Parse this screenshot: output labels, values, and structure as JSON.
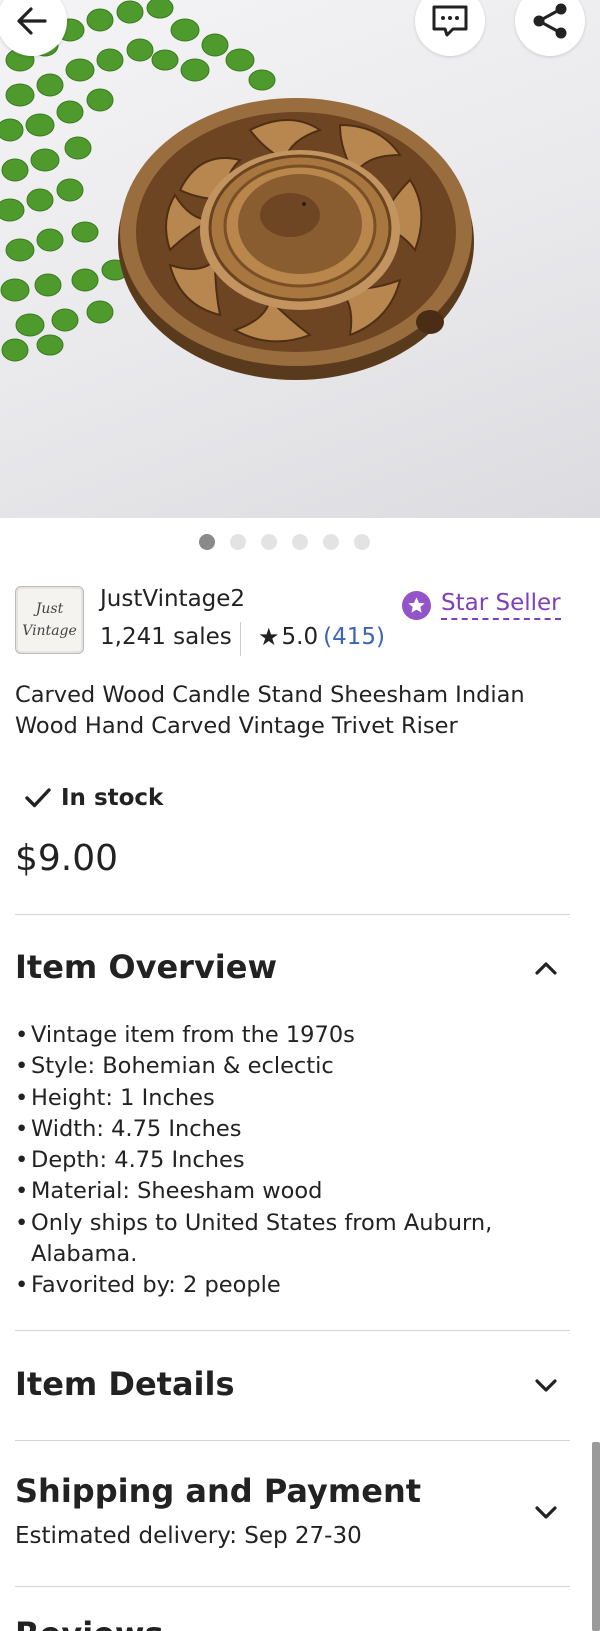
{
  "header": {
    "back_icon": "arrow-left-icon",
    "message_icon": "message-icon",
    "share_icon": "share-icon"
  },
  "carousel": {
    "total_images": 6,
    "active_index": 0
  },
  "seller": {
    "logo_line1": "Just",
    "logo_line2": "Vintage",
    "name": "JustVintage2",
    "sales": "1,241 sales",
    "rating": "5.0",
    "review_count": "(415)",
    "badge_label": "Star Seller",
    "badge_color": "#9254c8"
  },
  "listing": {
    "title": "Carved Wood Candle Stand Sheesham Indian Wood Hand Carved Vintage Trivet Riser",
    "stock_status": "In stock",
    "price": "$9.00"
  },
  "sections": {
    "overview": {
      "title": "Item Overview",
      "expanded": true,
      "items": [
        "Vintage item from the 1970s",
        "Style: Bohemian & eclectic",
        "Height: 1 Inches",
        "Width: 4.75 Inches",
        "Depth: 4.75 Inches",
        "Material: Sheesham wood",
        "Only ships to United States from Auburn, Alabama.",
        "Favorited by: 2 people"
      ]
    },
    "details": {
      "title": "Item Details",
      "expanded": false
    },
    "shipping": {
      "title": "Shipping and Payment",
      "subtitle": "Estimated delivery: Sep 27-30",
      "expanded": false
    },
    "reviews": {
      "title": "Reviews"
    }
  },
  "colors": {
    "link_blue": "#3d63b8",
    "star_seller_purple": "#7f3fb8",
    "text": "#222222"
  }
}
